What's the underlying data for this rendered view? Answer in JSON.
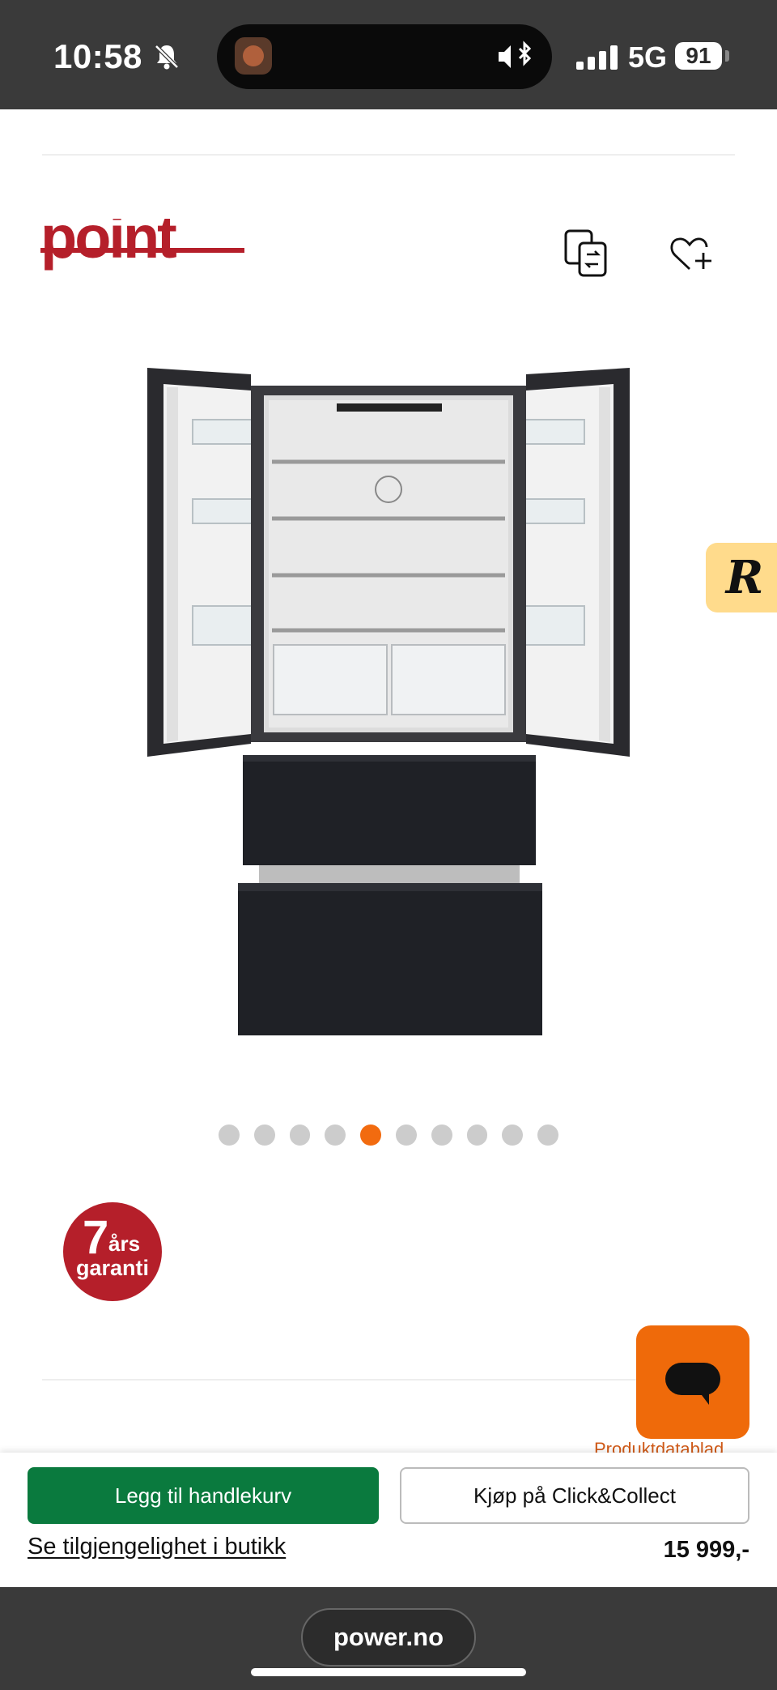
{
  "status_bar": {
    "time": "10:58",
    "network": "5G",
    "battery": "91",
    "icons": [
      "bell-slash-icon",
      "app-activity-icon",
      "speaker-bluetooth-icon",
      "signal-icon",
      "battery-icon"
    ]
  },
  "header": {
    "logo_text": "point",
    "logo_color": "#b51f2a",
    "icons": [
      "compare-icon",
      "heart-plus-icon"
    ]
  },
  "carousel": {
    "dot_count": 10,
    "active_index": 4,
    "active_color": "#f26b0f",
    "inactive_color": "#cccccc"
  },
  "review_badge": {
    "letter": "R",
    "color": "#ffdb8c"
  },
  "guarantee": {
    "number": "7",
    "unit": "års",
    "word": "garanti",
    "color": "#b51f2a"
  },
  "datasheet_link": "Produktdatablad",
  "chat": {
    "icon": "chat-bubble-icon",
    "color": "#ef6a0a"
  },
  "bottom_bar": {
    "add_to_cart": "Legg til handlekurv",
    "click_collect": "Kjøp på Click&Collect",
    "store_availability": "Se tilgjengelighet i butikk",
    "price": "15 999,-",
    "add_to_cart_color": "#0a7a3e"
  },
  "browser": {
    "url": "power.no"
  }
}
